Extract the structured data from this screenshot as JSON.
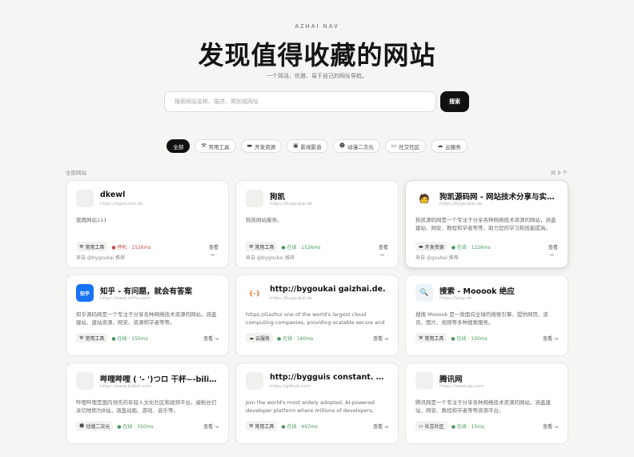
{
  "header": {
    "brand": "AZHAI NAV",
    "title": "发现值得收藏的网站",
    "subtitle": "一个简洁、优雅、易于自己的网址导航。"
  },
  "search": {
    "placeholder": "搜索网站名称、描述、类别或网址",
    "button_label": "搜索"
  },
  "tabs": [
    {
      "label": "全部",
      "icon": "grid-icon",
      "glyph": ""
    },
    {
      "label": "常用工具",
      "icon": "tool-icon",
      "glyph": "⚒"
    },
    {
      "label": "开发资源",
      "icon": "code-icon",
      "glyph": "▬"
    },
    {
      "label": "影视影音",
      "icon": "film-icon",
      "glyph": "▣"
    },
    {
      "label": "动漫二次元",
      "icon": "anime-icon",
      "glyph": "☻"
    },
    {
      "label": "社交社区",
      "icon": "chat-icon",
      "glyph": "▭"
    },
    {
      "label": "云服务",
      "icon": "cloud-icon",
      "glyph": "☁"
    }
  ],
  "section_label": "全部网站",
  "count_label": "共 9 个",
  "cards": [
    {
      "title": "dkewl",
      "url": "https://dgzouxhi.de",
      "desc": "我再网站111",
      "logo": "",
      "logo_icon": "placeholder-logo",
      "category": "常用工具",
      "cat_icon": "tool-icon",
      "cat_glyph": "⚒",
      "status": "● 停机 · 1526ms",
      "status_bad": true,
      "view": "查看",
      "recommender": "来自 @bygoukai 推荐"
    },
    {
      "title": "狗凯",
      "url": "https://bygoukai.de",
      "desc": "狗凯网站服务。",
      "logo": "",
      "logo_icon": "placeholder-logo",
      "category": "常用工具",
      "cat_icon": "tool-icon",
      "cat_glyph": "⚒",
      "status": "● 在线 · 1526ms",
      "status_bad": false,
      "view": "查看",
      "recommender": "来自 @bygoukai 推荐"
    },
    {
      "title": "狗凯源码网 - 网站技术分享与实用教程平台",
      "url": "https://bygoukai.de",
      "desc": "狗凯源码网是一个专注于分享各种网络技术资源的网站，涵盖建站、网安、教程和学者等等，助力您的学习和技能提高。",
      "logo": "🧑",
      "logo_icon": "avatar-logo",
      "category": "开发资源",
      "cat_icon": "code-icon",
      "cat_glyph": "▬",
      "status": "● 在线 · 1226ms",
      "status_bad": false,
      "view": "查看",
      "recommender": "来自 @goukai 推荐"
    },
    {
      "title": "知乎 - 有问题，就会有答案",
      "url": "https://www.zhihu.com",
      "desc": "知乎源码网是一个专注于分享各种网络技术资源的网站，涵盖建站、建站资源、网安、资源和学者等等。",
      "logo": "知乎",
      "logo_icon": "zhihu-logo",
      "category": "常用工具",
      "cat_icon": "tool-icon",
      "cat_glyph": "⚒",
      "status": "● 在线 · 150ms",
      "status_bad": false,
      "view": "查看 →",
      "recommender": ""
    },
    {
      "title": "http://bygoukai gaizhai.de.",
      "url": "https://bygoukai.de",
      "desc": "https://Gazhui one of the world's largest cloud computing companies, providing scalable secure and reliable cloud services.",
      "logo": "{-}",
      "logo_icon": "code-brackets-logo",
      "category": "云服务",
      "cat_icon": "cloud-icon",
      "cat_glyph": "☁",
      "status": "● 在线 · 160ms",
      "status_bad": false,
      "view": "查看 →",
      "recommender": ""
    },
    {
      "title": "搜索 - Mooook 绝应",
      "url": "https://blog.de",
      "desc": "搜搜 Mooook 是一款面向全球的搜索引擎，提供网页、资讯、图片、视频等多种搜索服务。",
      "logo": "🔍",
      "logo_icon": "search-logo",
      "category": "常用工具",
      "cat_icon": "tool-icon",
      "cat_glyph": "⚒",
      "status": "● 在线 · 100ms",
      "status_bad": false,
      "view": "查看 →",
      "recommender": ""
    },
    {
      "title": "哔哩哔哩 ( '- ')つロ 干杯~-bilibili",
      "url": "https://www.bilibili.com",
      "desc": "哔哩哔哩是国内领先的年轻人文化社区和视频平台，被粉丝们亲切地称为B站，涵盖动画、游戏、音乐等。",
      "logo": "",
      "logo_icon": "placeholder-logo",
      "category": "动漫二次元",
      "cat_icon": "anime-icon",
      "cat_glyph": "☻",
      "status": "● 在线 · 350ms",
      "status_bad": false,
      "view": "查看 →",
      "recommender": ""
    },
    {
      "title": "http://bygguis constant. Gitlu...",
      "url": "https://github.com",
      "desc": "Join the world's most widely adopted, AI-powered developer platform where millions of developers, businesses, and the...",
      "logo": "",
      "logo_icon": "placeholder-logo",
      "category": "常用工具",
      "cat_icon": "tool-icon",
      "cat_glyph": "⚒",
      "status": "● 在线 · 497ms",
      "status_bad": false,
      "view": "查看 →",
      "recommender": ""
    },
    {
      "title": "腾讯网",
      "url": "https://www.qq.com",
      "desc": "腾讯网是一个专注于分享各种网络技术资源的网站，涵盖建站、网安、教程和学者等等资源平台。",
      "logo": "",
      "logo_icon": "placeholder-logo",
      "category": "社交社区",
      "cat_icon": "chat-icon",
      "cat_glyph": "▭",
      "status": "● 在线 · 15ms",
      "status_bad": false,
      "view": "查看 →",
      "recommender": ""
    }
  ]
}
